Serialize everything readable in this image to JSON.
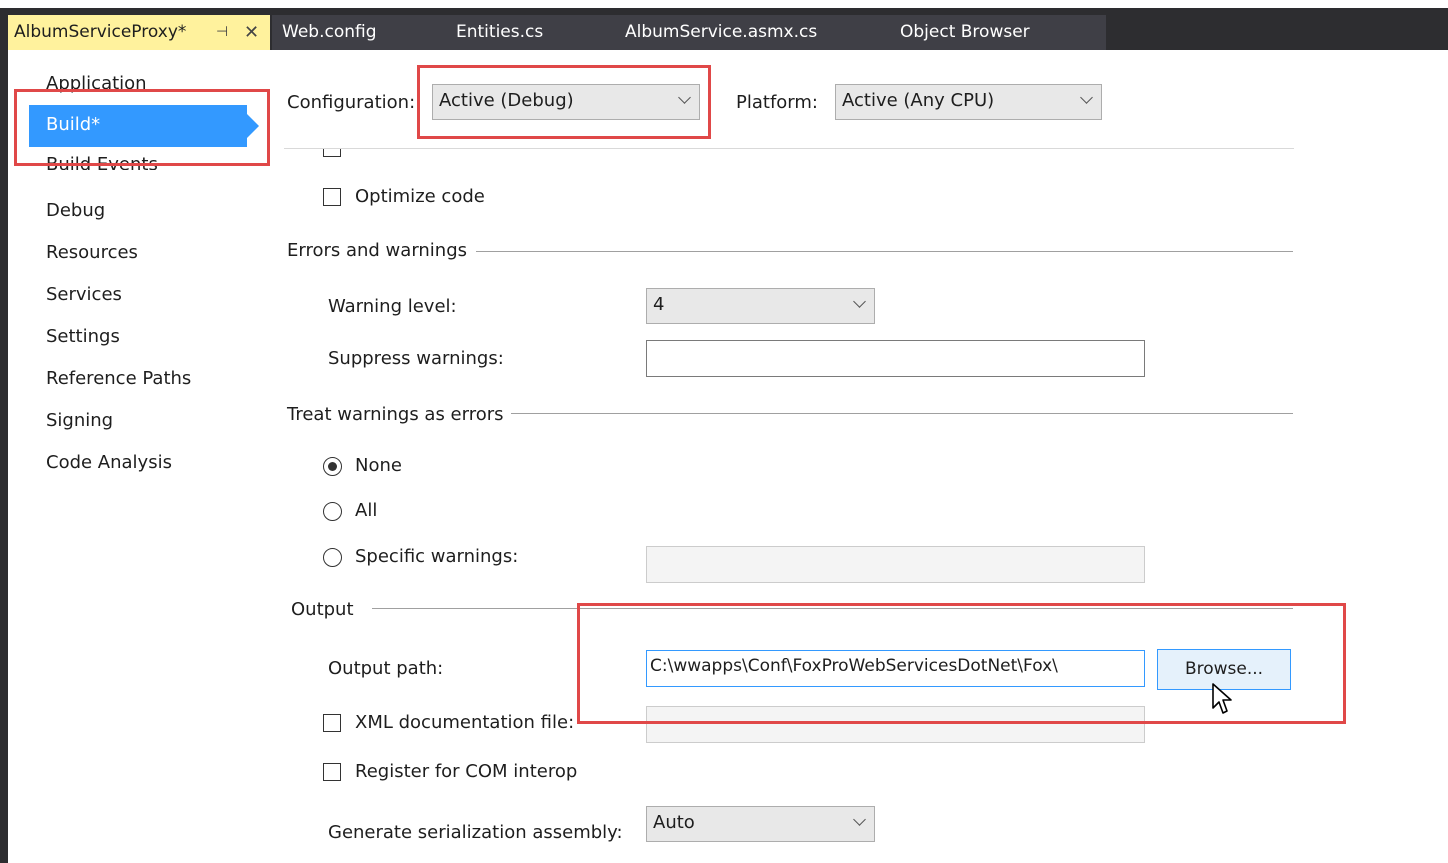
{
  "tabs": [
    {
      "label": "AlbumServiceProxy*",
      "active": true
    },
    {
      "label": "Web.config"
    },
    {
      "label": "Entities.cs"
    },
    {
      "label": "AlbumService.asmx.cs"
    },
    {
      "label": "Object Browser"
    }
  ],
  "tab_pin_glyph": "⊣",
  "tab_close_glyph": "✕",
  "nav": {
    "items": [
      "Application",
      "Build*",
      "Build Events",
      "Debug",
      "Resources",
      "Services",
      "Settings",
      "Reference Paths",
      "Signing",
      "Code Analysis"
    ],
    "selected": "Build*"
  },
  "toolbar": {
    "configuration_label": "Configuration:",
    "configuration_value": "Active (Debug)",
    "platform_label": "Platform:",
    "platform_value": "Active (Any CPU)"
  },
  "general": {
    "optimize_code_label": "Optimize code",
    "optimize_code_checked": false
  },
  "errors_and_warnings": {
    "header": "Errors and warnings",
    "warning_level_label": "Warning level:",
    "warning_level_value": "4",
    "suppress_warnings_label": "Suppress warnings:",
    "suppress_warnings_value": ""
  },
  "treat_warnings": {
    "header": "Treat warnings as errors",
    "options": [
      "None",
      "All",
      "Specific warnings:"
    ],
    "selected": "None",
    "specific_warnings_value": ""
  },
  "output": {
    "header": "Output",
    "output_path_label": "Output path:",
    "output_path_value": "C:\\wwapps\\Conf\\FoxProWebServicesDotNet\\Fox\\",
    "browse_label": "Browse...",
    "xml_doc_label": "XML documentation file:",
    "xml_doc_checked": false,
    "register_com_label": "Register for COM interop",
    "register_com_checked": false,
    "serialization_label": "Generate serialization assembly:",
    "serialization_value": "Auto"
  },
  "colors": {
    "active_tab": "#fff29d",
    "tabstrip": "#2d2d30",
    "nav_selected": "#3399ff",
    "highlight_box": "#e04848"
  }
}
